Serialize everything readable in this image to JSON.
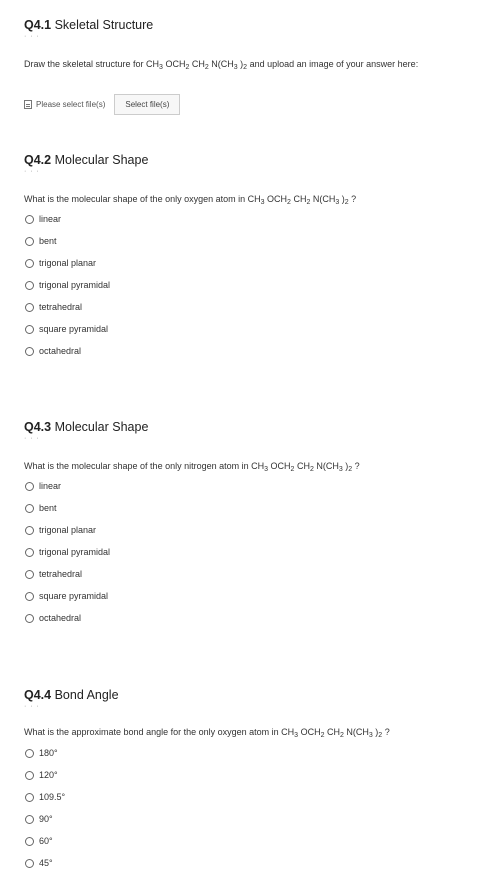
{
  "q1": {
    "number": "Q4.1",
    "title": "Skeletal Structure",
    "text_pre": "Draw the skeletal structure for CH",
    "text_rest": " and upload an image of your answer here:",
    "file_status": "Please select file(s)",
    "select_button": "Select file(s)"
  },
  "formula": {
    "ch": "CH",
    "three": "3",
    "och": " OCH",
    "two": "2",
    "ch2": " CH",
    "n": " N(CH",
    "close": " )",
    "q": " ?"
  },
  "q2": {
    "number": "Q4.2",
    "title": "Molecular Shape",
    "question_pre": "What is the molecular shape of the only oxygen atom in ",
    "options": [
      "linear",
      "bent",
      "trigonal planar",
      "trigonal pyramidal",
      "tetrahedral",
      "square pyramidal",
      "octahedral"
    ]
  },
  "q3": {
    "number": "Q4.3",
    "title": "Molecular Shape",
    "question_pre": "What is the molecular shape of the only nitrogen atom in ",
    "options": [
      "linear",
      "bent",
      "trigonal planar",
      "trigonal pyramidal",
      "tetrahedral",
      "square pyramidal",
      "octahedral"
    ]
  },
  "q4": {
    "number": "Q4.4",
    "title": "Bond Angle",
    "question_pre": "What is the approximate bond angle for the only oxygen atom in ",
    "options": [
      "180°",
      "120°",
      "109.5°",
      "90°",
      "60°",
      "45°"
    ]
  }
}
